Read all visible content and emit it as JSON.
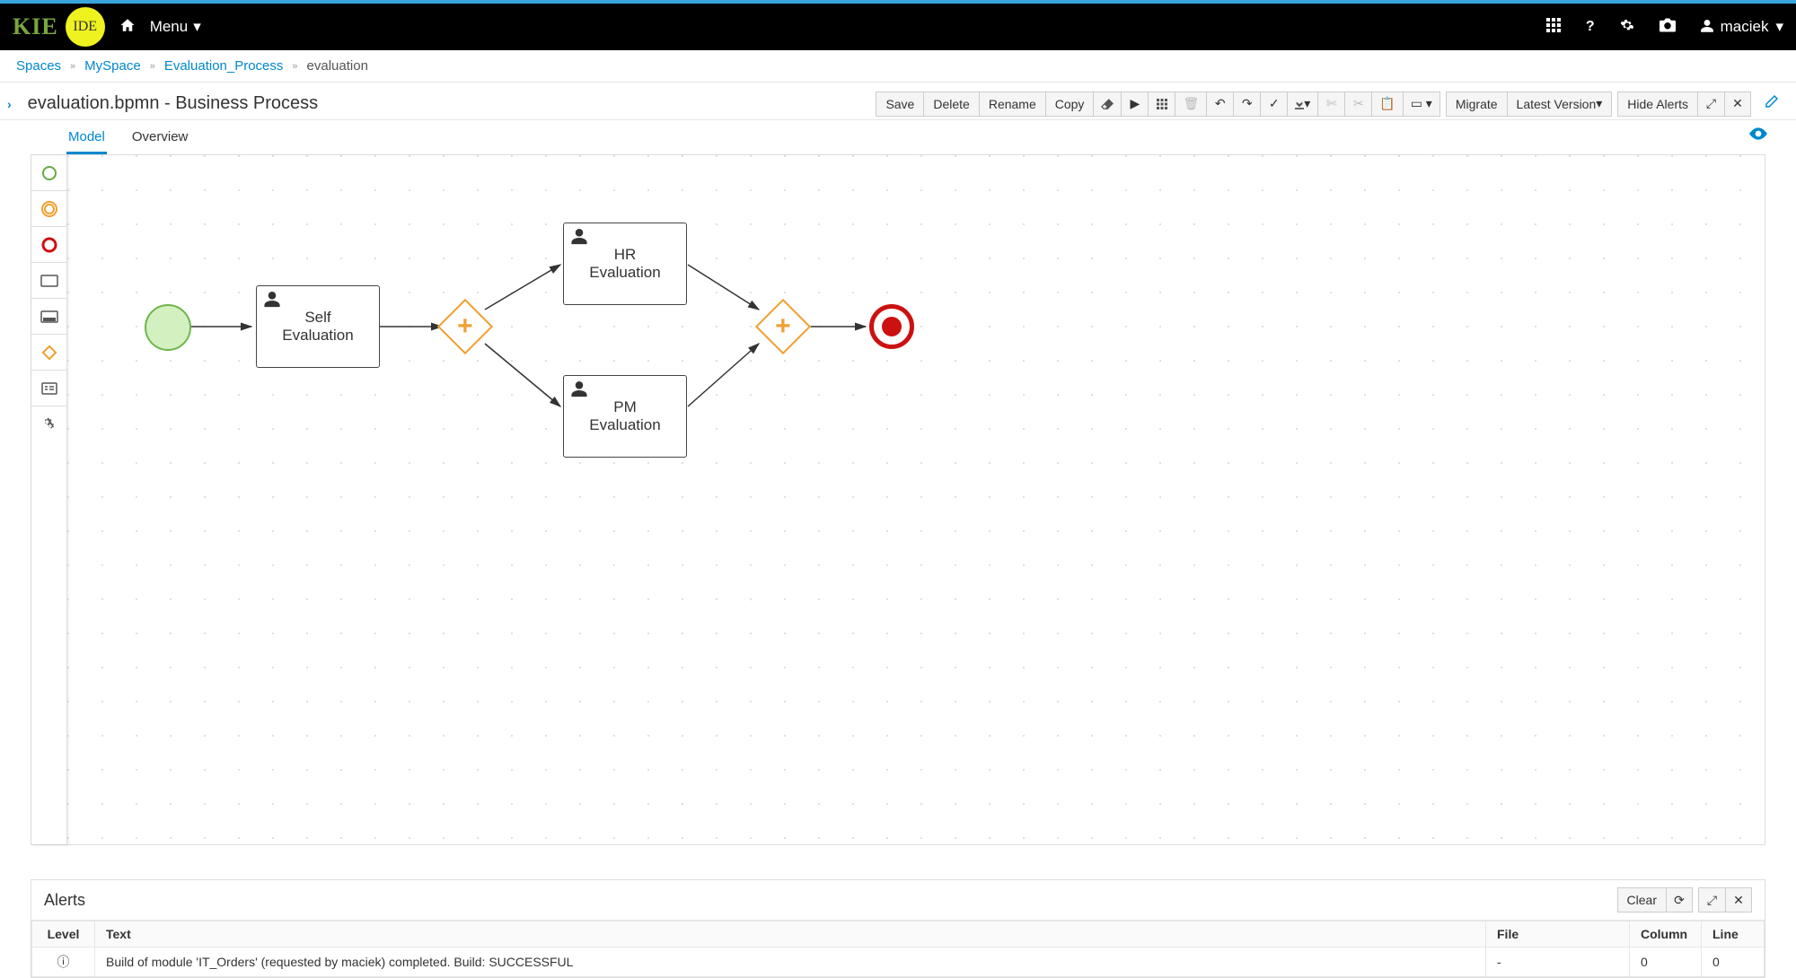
{
  "header": {
    "logo_kie": "KIE",
    "logo_ide": "IDE",
    "menu_label": "Menu",
    "user": "maciek"
  },
  "breadcrumb": {
    "items": [
      "Spaces",
      "MySpace",
      "Evaluation_Process"
    ],
    "current": "evaluation"
  },
  "page_title": "evaluation.bpmn - Business Process",
  "toolbar": {
    "save": "Save",
    "delete": "Delete",
    "rename": "Rename",
    "copy": "Copy",
    "migrate": "Migrate",
    "latest_version": "Latest Version",
    "hide_alerts": "Hide Alerts"
  },
  "tabs": {
    "model": "Model",
    "overview": "Overview"
  },
  "bpmn": {
    "task_self": "Self\nEvaluation",
    "task_hr": "HR\nEvaluation",
    "task_pm": "PM\nEvaluation"
  },
  "alerts": {
    "title": "Alerts",
    "clear": "Clear",
    "columns": {
      "level": "Level",
      "text": "Text",
      "file": "File",
      "column": "Column",
      "line": "Line"
    },
    "rows": [
      {
        "level": "ⓘ",
        "text": "Build of module 'IT_Orders' (requested by maciek) completed. Build: SUCCESSFUL",
        "file": "-",
        "column": "0",
        "line": "0"
      }
    ]
  }
}
